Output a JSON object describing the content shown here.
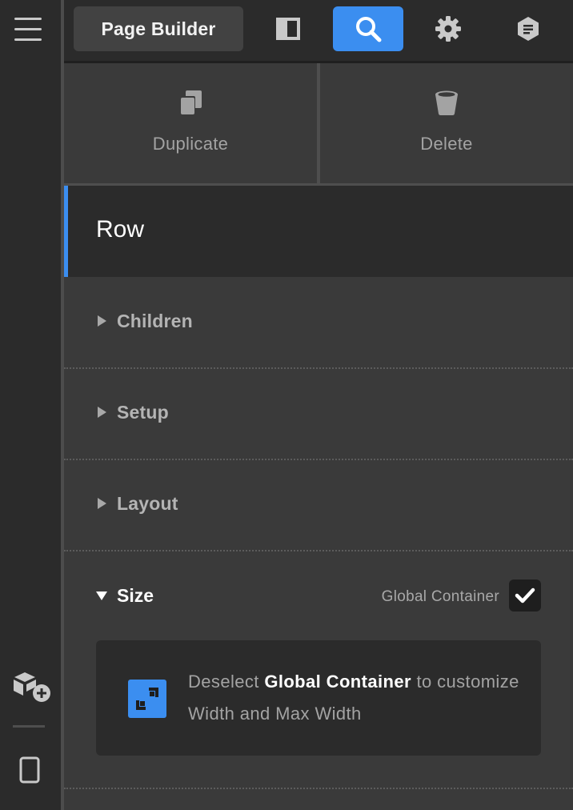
{
  "toolbar": {
    "page_builder_label": "Page Builder",
    "icons": [
      "layout-toggle-icon",
      "search-icon",
      "gear-icon",
      "notes-icon"
    ],
    "active_icon": "search-icon",
    "accent_color": "#3b8ef0"
  },
  "actions": {
    "duplicate_label": "Duplicate",
    "delete_label": "Delete"
  },
  "element": {
    "title": "Row"
  },
  "sections": {
    "children": "Children",
    "setup": "Setup",
    "layout": "Layout",
    "size": "Size"
  },
  "size": {
    "global_container_label": "Global Container",
    "global_container_checked": true,
    "info_prefix": "Deselect ",
    "info_bold": "Global Container",
    "info_suffix": " to customize Width and Max Width"
  },
  "rail": {
    "icons": [
      "menu-icon",
      "add-element-icon",
      "device-preview-icon"
    ]
  }
}
